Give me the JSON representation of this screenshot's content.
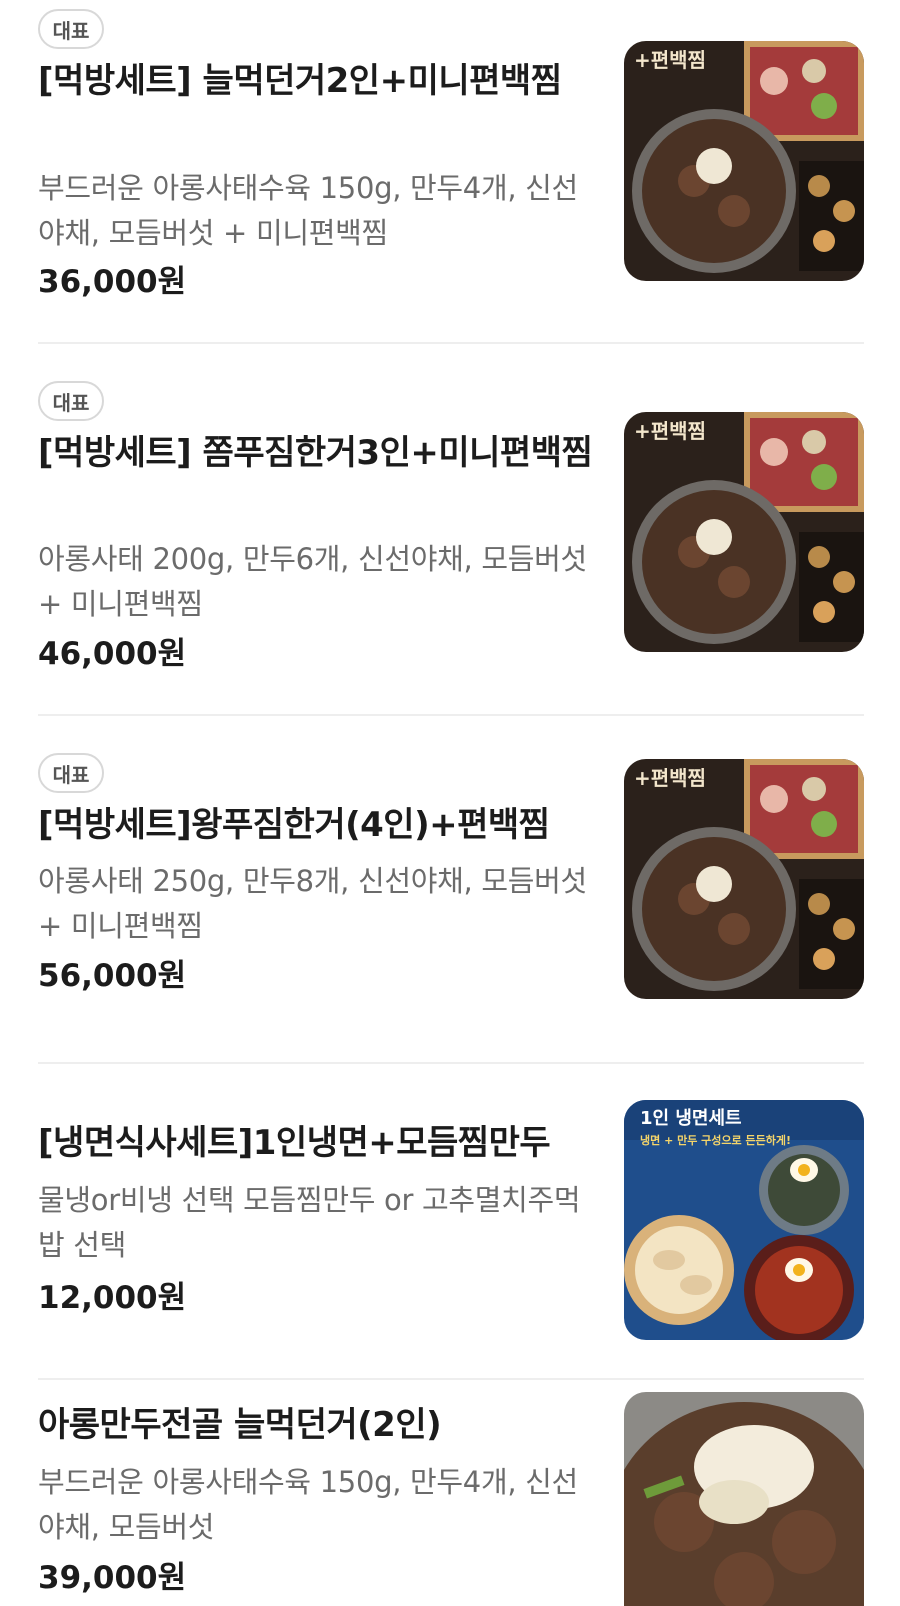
{
  "menu": {
    "items": [
      {
        "badge": "대표",
        "name": "[먹방세트] 늘먹던거2인+미니편백찜",
        "description": "부드러운 아롱사태수육 150g, 만두4개, 신선야채, 모듬버섯 + 미니편백찜",
        "price": "36,000원",
        "image_icon": "steamed-beef-set-photo"
      },
      {
        "badge": "대표",
        "name": "[먹방세트] 쫌푸짐한거3인+미니편백찜",
        "description": "아롱사태 200g, 만두6개, 신선야채, 모듬버섯 + 미니편백찜",
        "price": "46,000원",
        "image_icon": "steamed-beef-set-photo"
      },
      {
        "badge": "대표",
        "name": "[먹방세트]왕푸짐한거(4인)+편백찜",
        "description": "아롱사태 250g, 만두8개, 신선야채, 모듬버섯 + 미니편백찜",
        "price": "56,000원",
        "image_icon": "steamed-beef-set-photo"
      },
      {
        "badge": "",
        "name": "[냉면식사세트]1인냉면+모듬찜만두",
        "description": "물냉or비냉 선택 모듬찜만두 or 고추멸치주먹밥 선택",
        "price": "12,000원",
        "image_icon": "cold-noodle-set-photo"
      },
      {
        "badge": "",
        "name": "아롱만두전골 늘먹던거(2인)",
        "description": "부드러운 아롱사태수육 150g, 만두4개, 신선야채, 모듬버섯",
        "price": "39,000원",
        "image_icon": "dumpling-hotpot-photo"
      }
    ]
  },
  "image_text": {
    "steam_set_title": "+편백찜",
    "noodle_set_title": "1인 냉면세트",
    "noodle_set_sub": "냉면 + 만두 구성으로 든든하게!"
  },
  "colors": {
    "name": "#1c1c1c",
    "description": "#6b6b6b",
    "badge_border": "#d8d8d8",
    "divider": "#eeeeee"
  }
}
